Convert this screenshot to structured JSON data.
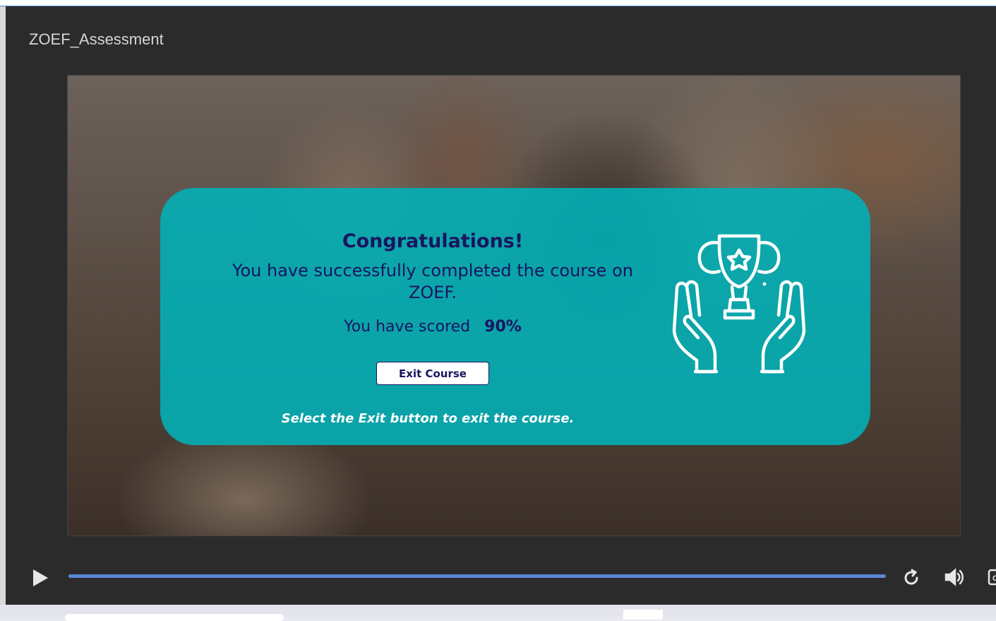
{
  "player": {
    "course_title": "ZOEF_Assessment",
    "progress_fraction": 1.0,
    "controls": {
      "play_icon": "play-icon",
      "replay_icon": "replay-icon",
      "volume_icon": "volume-icon",
      "captions_icon": "closed-captions-icon",
      "captions_label": "CC"
    }
  },
  "slide": {
    "heading": "Congratulations!",
    "completed_text": "You have successfully completed the course on ZOEF.",
    "score_label": "You have scored",
    "score_value": "90%",
    "exit_button_label": "Exit Course",
    "instruction": "Select the Exit button to exit the course.",
    "icon": "trophy-in-hands-icon"
  },
  "colors": {
    "card": "#00b2b8",
    "text_dark": "#1a1560",
    "progress": "#5a87d4",
    "player_bg": "#2b2b2b"
  }
}
